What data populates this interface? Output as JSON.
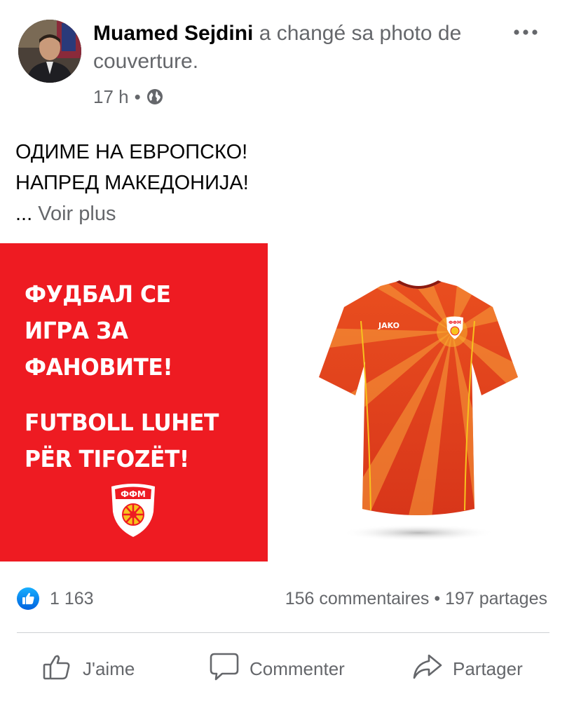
{
  "post": {
    "author": "Muamed Sejdini",
    "action_text": " a changé sa photo de couverture.",
    "time": "17 h",
    "separator": "•",
    "text_line1": "ОДИМЕ НА ЕВРОПСКО!",
    "text_line2": "НАПРЕД МАКЕДОНИЈА!",
    "ellipsis": "... ",
    "see_more": "Voir plus"
  },
  "image": {
    "line1": "ФУДБАЛ СЕ",
    "line2": "ИГРА ЗА",
    "line3": "ФАНОВИТЕ!",
    "line4": "FUTBOLL LUHET",
    "line5": "PËR TIFOZËT!",
    "badge_text": "ФФМ",
    "shirt_brand": "JAKO",
    "shirt_badge_text": "ФФМ"
  },
  "stats": {
    "reactions": "1 163",
    "comments": "156 commentaires",
    "separator": "•",
    "shares": "197 partages"
  },
  "actions": {
    "like": "J'aime",
    "comment": "Commenter",
    "share": "Partager"
  },
  "colors": {
    "facebook_blue": "#1877f2",
    "promo_red": "#ee1b22",
    "secondary_text": "#65676b"
  }
}
